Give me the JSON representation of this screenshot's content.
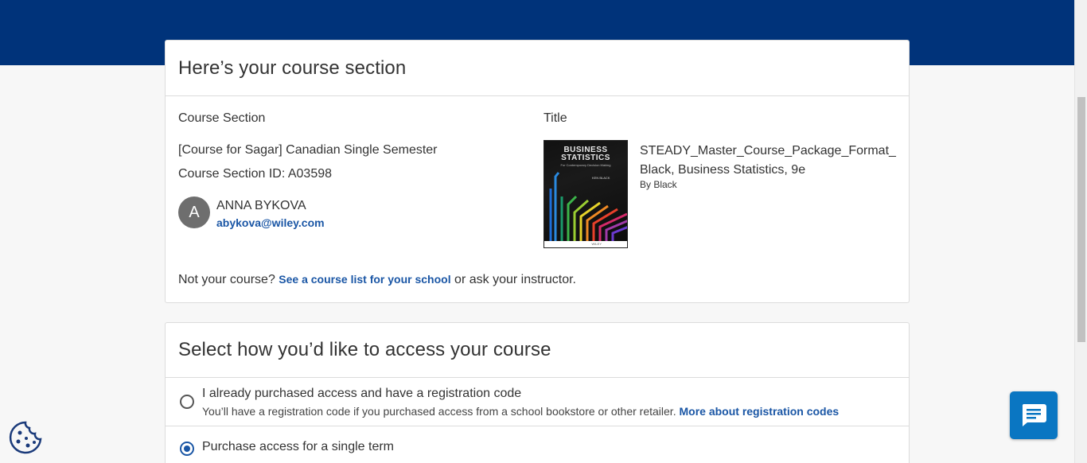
{
  "card1": {
    "heading": "Here’s your course section",
    "course_section_label": "Course Section",
    "title_label": "Title",
    "course_name": "[Course for Sagar] Canadian Single Semester",
    "section_id": "Course Section ID: A03598",
    "instructor": {
      "initial": "A",
      "name": "ANNA BYKOVA",
      "email": "abykova@wiley.com"
    },
    "book": {
      "cover_title": "BUSINESS STATISTICS",
      "cover_subtitle": "For Contemporary Decision Making",
      "cover_author": "KEN BLACK",
      "cover_publisher": "WILEY",
      "title": "STEADY_Master_Course_Package_Format_Black, Business Statistics, 9e",
      "by": "By Black"
    },
    "not_course_prefix": "Not your course?",
    "course_list_link": "See a course list for your school",
    "not_course_suffix": "or ask your instructor."
  },
  "card2": {
    "heading": "Select how you’d like to access your course",
    "options": [
      {
        "label": "I already purchased access and have a registration code",
        "description": "You’ll have a registration code if you purchased access from a school bookstore or other retailer.",
        "link": "More about registration codes",
        "selected": false
      },
      {
        "label": "Purchase access for a single term",
        "selected": true
      }
    ]
  },
  "icons": {
    "chat": "chat-icon",
    "cookie": "cookie-icon"
  },
  "colors": {
    "header": "#00337a",
    "link": "#1a56a5",
    "chat_button": "#0a76c2"
  }
}
